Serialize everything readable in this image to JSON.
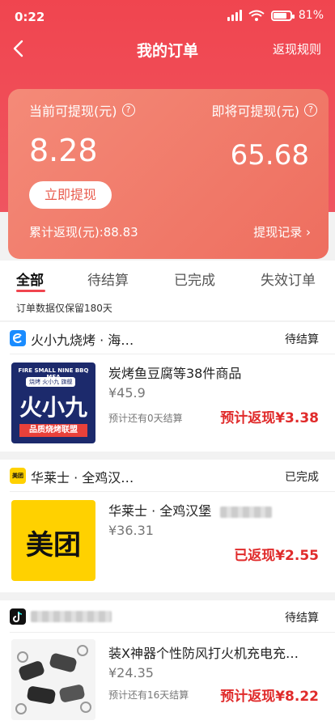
{
  "status_bar": {
    "time": "0:22",
    "battery": "81%"
  },
  "nav": {
    "title": "我的订单",
    "right_link": "返现规则"
  },
  "balance_card": {
    "current_label": "当前可提现(元)",
    "current_value": "8.28",
    "pending_label": "即将可提现(元)",
    "pending_value": "65.68",
    "withdraw_button": "立即提现",
    "total_label": "累计返现(元):88.83",
    "record_link": "提现记录 ›"
  },
  "tabs": [
    "全部",
    "待结算",
    "已完成",
    "失效订单"
  ],
  "notice": "订单数据仅保留180天",
  "orders": [
    {
      "shop": "火小九烧烤 · 海…",
      "status": "待结算",
      "title": "炭烤鱼豆腐等38件商品",
      "price": "¥45.9",
      "note": "预计还有0天结算",
      "rebate": "预计返现¥3.38",
      "thumb_text": "火小九",
      "thumb_top": "FIRE SMALL NINE BBQ MEA",
      "thumb_tag": "烧烤 火小九 旗舰",
      "thumb_bottom": "品质烧烤联盟",
      "logo_color": "#1a8cff"
    },
    {
      "shop": "华莱士 · 全鸡汉…",
      "status": "已完成",
      "title": "华莱士 · 全鸡汉堡",
      "price": "¥36.31",
      "note": "",
      "rebate": "已返现¥2.55",
      "thumb_text": "美团",
      "logo_text": "美团",
      "logo_color": "#ffd100"
    },
    {
      "shop": "",
      "status": "待结算",
      "title": "装X神器个性防风打火机充电充…",
      "price": "¥24.35",
      "note": "预计还有16天结算",
      "rebate": "预计返现¥8.22",
      "logo_color": "#111111"
    }
  ],
  "colors": {
    "brand_red": "#f0454f",
    "rebate_red": "#e02b2b"
  }
}
